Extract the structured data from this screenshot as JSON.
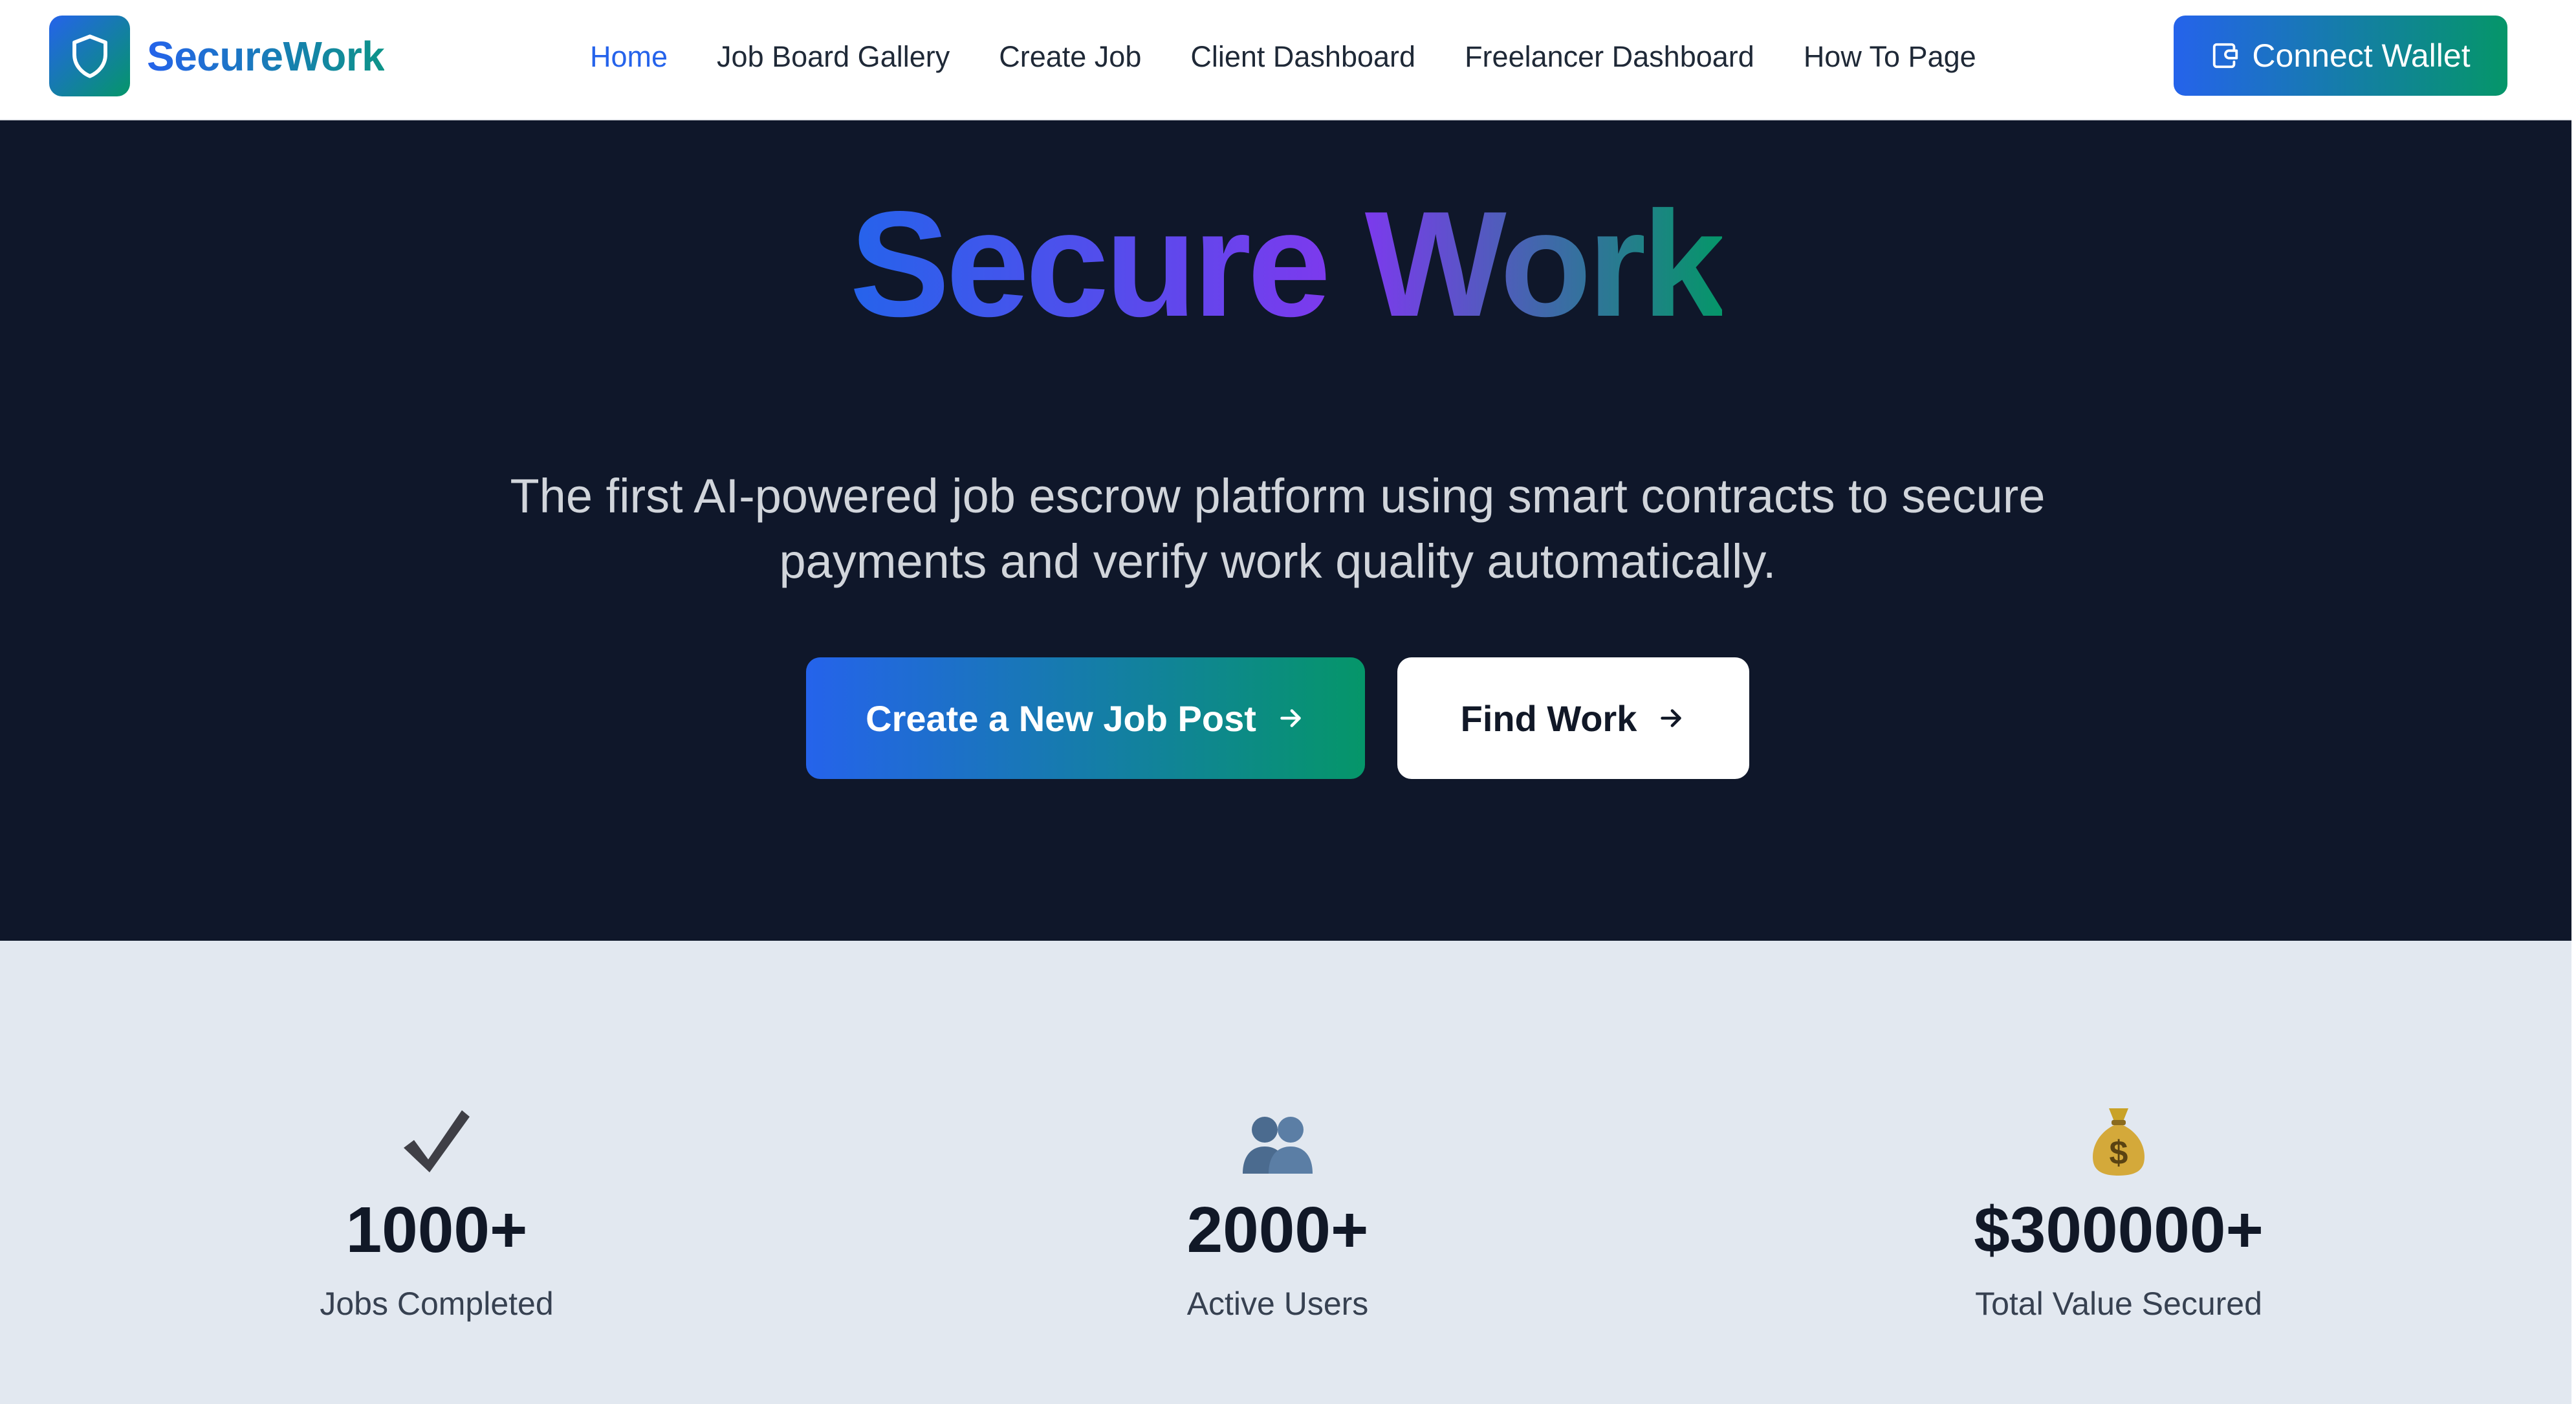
{
  "brand": {
    "name": "SecureWork"
  },
  "nav": {
    "items": [
      {
        "label": "Home",
        "active": true
      },
      {
        "label": "Job Board Gallery",
        "active": false
      },
      {
        "label": "Create Job",
        "active": false
      },
      {
        "label": "Client Dashboard",
        "active": false
      },
      {
        "label": "Freelancer Dashboard",
        "active": false
      },
      {
        "label": "How To Page",
        "active": false
      }
    ],
    "connect_wallet": "Connect Wallet"
  },
  "hero": {
    "title_word1": "Secure",
    "title_word2": "Work",
    "subtitle": "The first AI-powered job escrow platform using smart contracts to secure payments and verify work quality automatically.",
    "primary_button": "Create a New Job Post",
    "secondary_button": "Find Work"
  },
  "stats": [
    {
      "icon": "check-icon",
      "glyph": "✔",
      "value": "1000+",
      "label": "Jobs Completed"
    },
    {
      "icon": "users-icon",
      "glyph": "👥",
      "value": "2000+",
      "label": "Active Users"
    },
    {
      "icon": "money-bag-icon",
      "glyph": "💰",
      "value": "$300000+",
      "label": "Total Value Secured"
    }
  ],
  "colors": {
    "accent_blue": "#2563eb",
    "accent_green": "#059669",
    "accent_purple": "#7c3aed",
    "hero_bg": "#0f172a",
    "stats_bg": "#e2e8f0"
  }
}
